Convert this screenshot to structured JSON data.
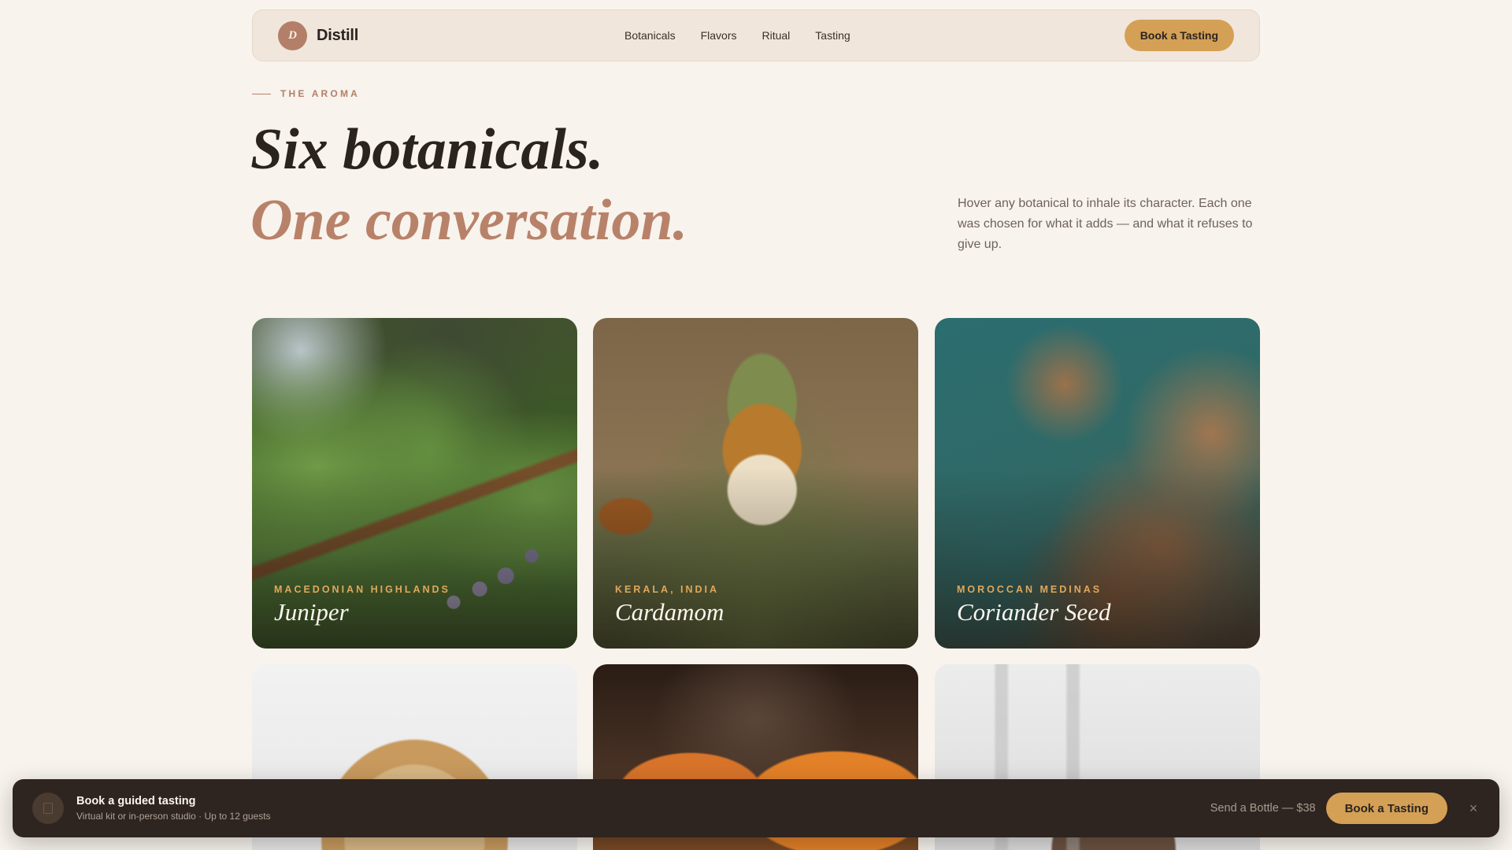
{
  "nav": {
    "logo_letter": "D",
    "brand": "Distill",
    "links": [
      "Botanicals",
      "Flavors",
      "Ritual",
      "Tasting"
    ],
    "cta": "Book a Tasting"
  },
  "hero": {
    "eyebrow": "THE AROMA",
    "headline_1": "Six botanicals.",
    "headline_2": "One conversation.",
    "description": "Hover any botanical to inhale its character. Each one was chosen for what it adds — and what it refuses to give up."
  },
  "botanicals": [
    {
      "origin": "MACEDONIAN HIGHLANDS",
      "name": "Juniper"
    },
    {
      "origin": "KERALA, INDIA",
      "name": "Cardamom"
    },
    {
      "origin": "MOROCCAN MEDINAS",
      "name": "Coriander Seed"
    }
  ],
  "booking_bar": {
    "title": "Book a guided tasting",
    "subtitle": "Virtual kit or in-person studio · Up to 12 guests",
    "secondary": "Send a Bottle — $38",
    "cta": "Book a Tasting",
    "close": "×"
  },
  "colors": {
    "background": "#f8f3ed",
    "accent": "#d4a055",
    "terracotta": "#b8826a",
    "dark": "#2e2420"
  }
}
